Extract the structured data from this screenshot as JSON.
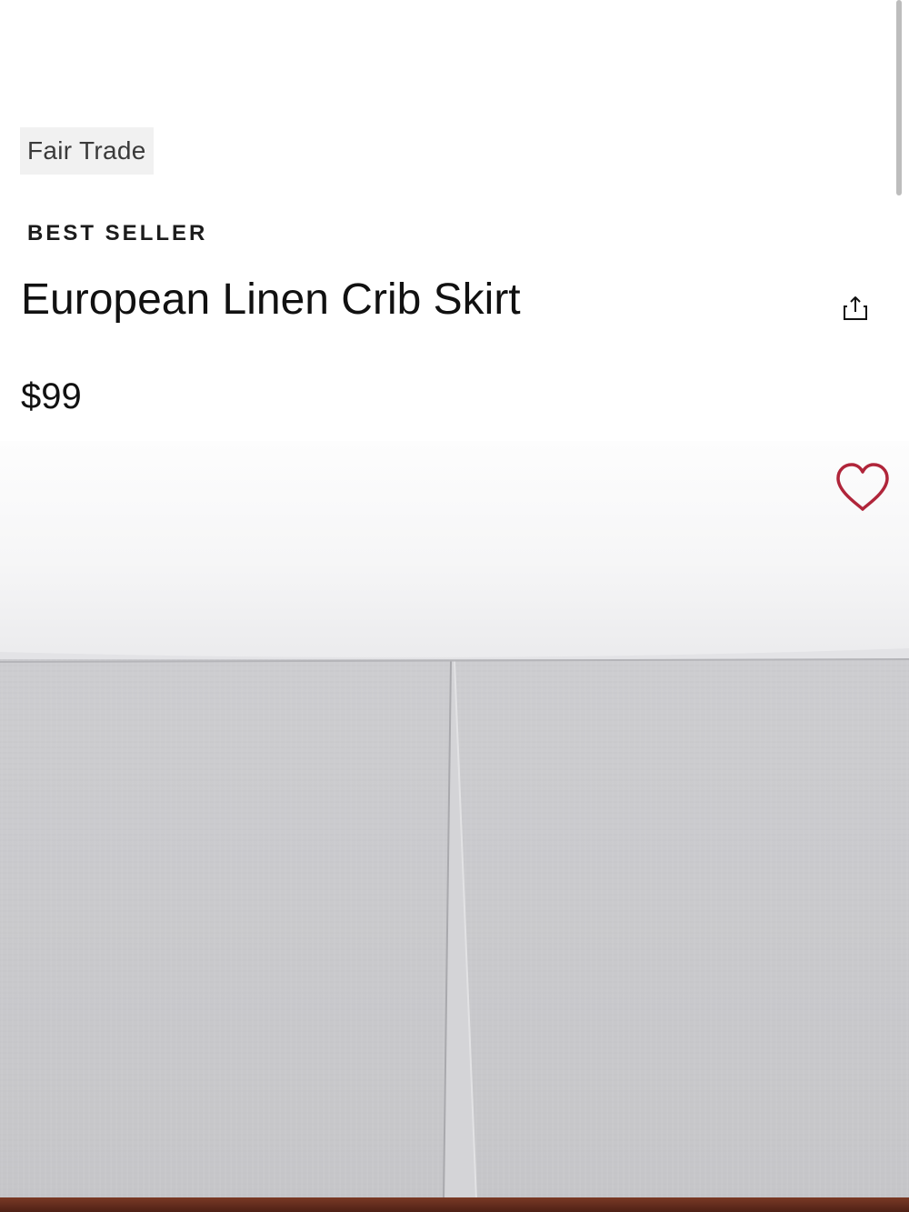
{
  "product": {
    "badge": "Fair Trade",
    "eyebrow": "BEST SELLER",
    "title": "European Linen Crib Skirt",
    "price": "$99"
  },
  "icons": {
    "share": "share-icon",
    "favorite": "heart-icon"
  },
  "colors": {
    "heart": "#b0253a",
    "skirt": "#c9c9cc",
    "mattress": "#f7f7f7"
  }
}
